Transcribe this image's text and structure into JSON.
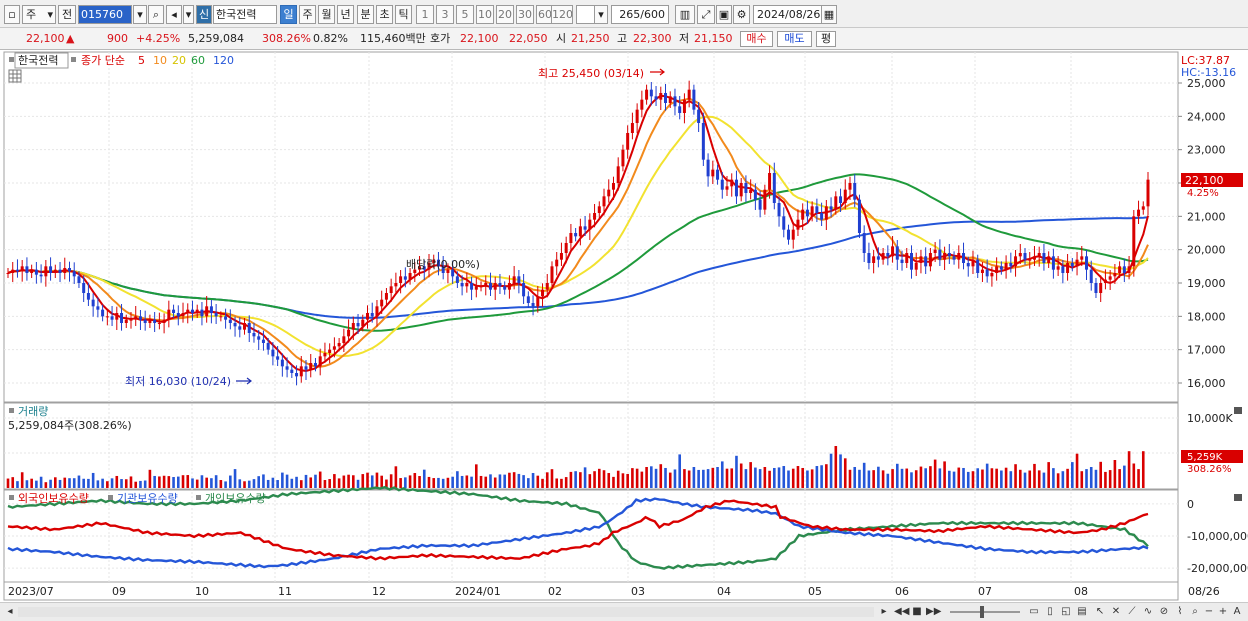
{
  "toolbar": {
    "type_select": "주",
    "prev_label": "전",
    "code": "015760",
    "badge": "신",
    "stock_name": "한국전력",
    "periods": [
      "일",
      "주",
      "월",
      "년",
      "분",
      "초",
      "틱"
    ],
    "active_period": "일",
    "counts": [
      "1",
      "3",
      "5",
      "10",
      "20",
      "30",
      "60",
      "120"
    ],
    "view_count": "265",
    "view_total": "/600",
    "date": "2024/08/26"
  },
  "quote": {
    "price": "22,100",
    "change": "900",
    "change_pct": "+4.25%",
    "volume": "5,259,084",
    "volume_pct": "308.26%",
    "turnover": "0.82%",
    "amount": "115,460백만",
    "bid_label": "호가",
    "ask": "22,100",
    "bid": "22,050",
    "open_label": "시",
    "open": "21,250",
    "high_label": "고",
    "high": "22,300",
    "low_label": "저",
    "low": "21,150",
    "buy_label": "매수",
    "sell_label": "매도",
    "eval_label": "평"
  },
  "price_panel": {
    "name": "한국전력",
    "ma_label": "종가 단순",
    "ma_periods": [
      "5",
      "10",
      "20",
      "60",
      "120"
    ],
    "lc": "LC:37.87",
    "hc": "HC:-13.16",
    "high_annotation": "최고 25,450 (03/14)",
    "low_annotation": "최저 16,030 (10/24)",
    "ex_dividend": "배당락(0.00%)",
    "last_price": "22,100",
    "last_pct": "4.25%"
  },
  "volume_panel": {
    "title": "거래량",
    "value": "5,259,084주(308.26%)",
    "last_value": "5,259K",
    "last_pct": "308.26%"
  },
  "holding_panel": {
    "series": [
      "외국인보유수량",
      "기관보유수량",
      "개인보유수량"
    ]
  },
  "chart_data": [
    {
      "type": "candlestick",
      "panel": "price",
      "y_axis_ticks": [
        16000,
        17000,
        18000,
        19000,
        20000,
        21000,
        22000,
        23000,
        24000,
        25000
      ],
      "y_tick_labels": [
        "16,000",
        "17,000",
        "18,000",
        "19,000",
        "20,000",
        "21,000",
        "22,000",
        "23,000",
        "24,000",
        "25,000"
      ],
      "ylim": [
        15600,
        25650
      ],
      "x_tick_labels": [
        "2023/07",
        "09",
        "10",
        "11",
        "12",
        "2024/01",
        "02",
        "03",
        "04",
        "05",
        "06",
        "07",
        "08",
        "08/26"
      ],
      "close": [
        19300,
        19400,
        19350,
        19500,
        19300,
        19400,
        19250,
        19200,
        19500,
        19300,
        19400,
        19300,
        19450,
        19350,
        19200,
        19000,
        18700,
        18500,
        18300,
        18200,
        18000,
        18000,
        17900,
        18100,
        17800,
        17900,
        17900,
        18000,
        17900,
        17800,
        17900,
        17800,
        17800,
        17900,
        18200,
        18100,
        18000,
        18100,
        18200,
        18100,
        18200,
        18000,
        18300,
        18100,
        18000,
        18000,
        17900,
        17800,
        17700,
        17600,
        17800,
        17500,
        17400,
        17300,
        17200,
        17000,
        16800,
        16700,
        16500,
        16400,
        16300,
        16200,
        16500,
        16400,
        16600,
        16500,
        16800,
        16900,
        17000,
        17100,
        17200,
        17400,
        17600,
        17800,
        17700,
        17900,
        18100,
        18000,
        18300,
        18500,
        18700,
        18900,
        19000,
        19200,
        19100,
        19300,
        19400,
        19500,
        19400,
        19600,
        19700,
        19500,
        19300,
        19400,
        19200,
        19000,
        18900,
        19000,
        18800,
        18900,
        18900,
        19000,
        18800,
        19000,
        18900,
        18800,
        19000,
        19200,
        19000,
        18600,
        18400,
        18300,
        18600,
        18800,
        19000,
        19500,
        19700,
        19900,
        20200,
        20500,
        20400,
        20700,
        20600,
        20900,
        21100,
        21300,
        21600,
        21800,
        22000,
        22500,
        23000,
        23500,
        23800,
        24200,
        24500,
        24800,
        24600,
        24500,
        24700,
        24400,
        24600,
        24300,
        24100,
        24500,
        24800,
        24200,
        23800,
        22700,
        22200,
        22400,
        22100,
        21800,
        21900,
        22100,
        21600,
        22000,
        21700,
        21800,
        21500,
        21200,
        21800,
        22300,
        21400,
        21000,
        20600,
        20300,
        20600,
        20900,
        21200,
        21000,
        21300,
        21100,
        20900,
        21300,
        21200,
        21600,
        21400,
        21800,
        22000,
        21500,
        20500,
        19900,
        19600,
        19800,
        19700,
        19900,
        19800,
        20100,
        19700,
        19600,
        19900,
        19400,
        19600,
        19800,
        19500,
        19900,
        20000,
        19700,
        19900,
        19800,
        19700,
        19900,
        19600,
        19500,
        19700,
        19300,
        19400,
        19200,
        19300,
        19500,
        19400,
        19600,
        19500,
        19800,
        19900,
        19700,
        19700,
        19800,
        19900,
        19600,
        19800,
        19400,
        19500,
        19300,
        19600,
        19500,
        19700,
        19800,
        19400,
        19000,
        18700,
        19000,
        19100,
        19200,
        19300,
        19500,
        19300,
        19500,
        21000,
        21200,
        21300,
        22100
      ]
    },
    {
      "type": "line",
      "panel": "price",
      "series": [
        {
          "name": "5",
          "color": "#d90000"
        },
        {
          "name": "10",
          "color": "#f28a1c"
        },
        {
          "name": "20",
          "color": "#f2e230"
        },
        {
          "name": "60",
          "color": "#1f9a3b"
        },
        {
          "name": "120",
          "color": "#2456d8"
        }
      ]
    },
    {
      "type": "bar",
      "panel": "volume",
      "y_axis_ticks": [
        5000,
        10000
      ],
      "y_tick_labels": [
        "5,000K",
        "10,000K"
      ],
      "ylim": [
        0,
        12000
      ],
      "values": [
        1350,
        1550,
        980,
        2250,
        1110,
        1330,
        1050,
        1610,
        830,
        1180,
        1530,
        1150,
        1480,
        1400,
        1400,
        1780,
        1320,
        1300,
        2150,
        1090,
        1330,
        970,
        1380,
        1720,
        1280,
        1250,
        1650,
        900,
        1010,
        1070,
        2600,
        1720,
        1650,
        1750,
        1700,
        1570,
        1630,
        1830,
        1850,
        1370,
        1200,
        1820,
        1480,
        1400,
        1830,
        1140,
        940,
        1780,
        2700,
        1240,
        960,
        1050,
        1270,
        1690,
        1940,
        1150,
        1470,
        1140,
        2200,
        1910,
        1320,
        1600,
        1120,
        1870,
        1510,
        1900,
        2350,
        1140,
        1280,
        1990,
        1370,
        1780,
        1900,
        1820,
        1170,
        1990,
        2190,
        1800,
        2200,
        1760,
        1210,
        1960,
        3100,
        1420,
        1520,
        1800,
        2140,
        1710,
        2620,
        1580,
        1420,
        1440,
        1310,
        1460,
        1610,
        2400,
        1720,
        1790,
        1620,
        3380,
        1720,
        1620,
        1950,
        1500,
        1940,
        1910,
        2180,
        2260,
        2010,
        1840,
        1410,
        2140,
        1760,
        1310,
        2240,
        2690,
        1360,
        1310,
        1560,
        2300,
        2400,
        2260,
        2950,
        1980,
        2400,
        2740,
        2540,
        2140,
        1590,
        2470,
        2100,
        2000,
        2840,
        2760,
        2340,
        3000,
        3100,
        2740,
        3400,
        2860,
        2200,
        2650,
        4800,
        2700,
        2500,
        3000,
        2580,
        2600,
        2700,
        2880,
        3000,
        3800,
        2760,
        2800,
        4600,
        3500,
        2700,
        3700,
        2920,
        2700,
        3000,
        2460,
        2860,
        2940,
        3140,
        2500,
        2760,
        3140,
        2860,
        2500,
        2660,
        3140,
        3250,
        3400,
        4900,
        6000,
        4800,
        4240,
        2600,
        3000,
        2600,
        3600,
        2500,
        2550,
        3040,
        2520,
        2040,
        2700,
        3460,
        2740,
        2780,
        2240,
        2540,
        3060,
        2820,
        3120,
        4060,
        2800,
        3800,
        2460,
        2340,
        2920,
        2860,
        2300,
        2400,
        2820,
        2640,
        3480,
        2820,
        2760,
        2500,
        2900,
        2400,
        3400,
        2600,
        2200,
        2500,
        3440,
        2520,
        2200,
        3700,
        2840,
        2100,
        2400,
        2740,
        3700,
        4900,
        2400,
        2700,
        3000,
        2600,
        3740,
        2300,
        2560,
        4000,
        2700,
        3200,
        5259,
        3500,
        2700,
        5259
      ],
      "annotated_last": "5,259K"
    },
    {
      "type": "line",
      "panel": "holding",
      "y_axis_ticks": [
        0,
        -10000000,
        -20000000
      ],
      "y_tick_labels": [
        "0",
        "-10,000,000",
        "-20,000,000"
      ],
      "ylim": [
        -24000000,
        4000000
      ],
      "series": [
        {
          "name": "외국인보유수량",
          "color": "#d90000"
        },
        {
          "name": "기관보유수량",
          "color": "#2456d8"
        },
        {
          "name": "개인보유수량",
          "color": "#2c8a4e"
        }
      ]
    }
  ],
  "bottom_bar": {
    "icons": [
      "scroll-left-icon",
      "scroll-right-icon",
      "play-back-icon",
      "stop-icon",
      "play-forward-icon"
    ]
  }
}
